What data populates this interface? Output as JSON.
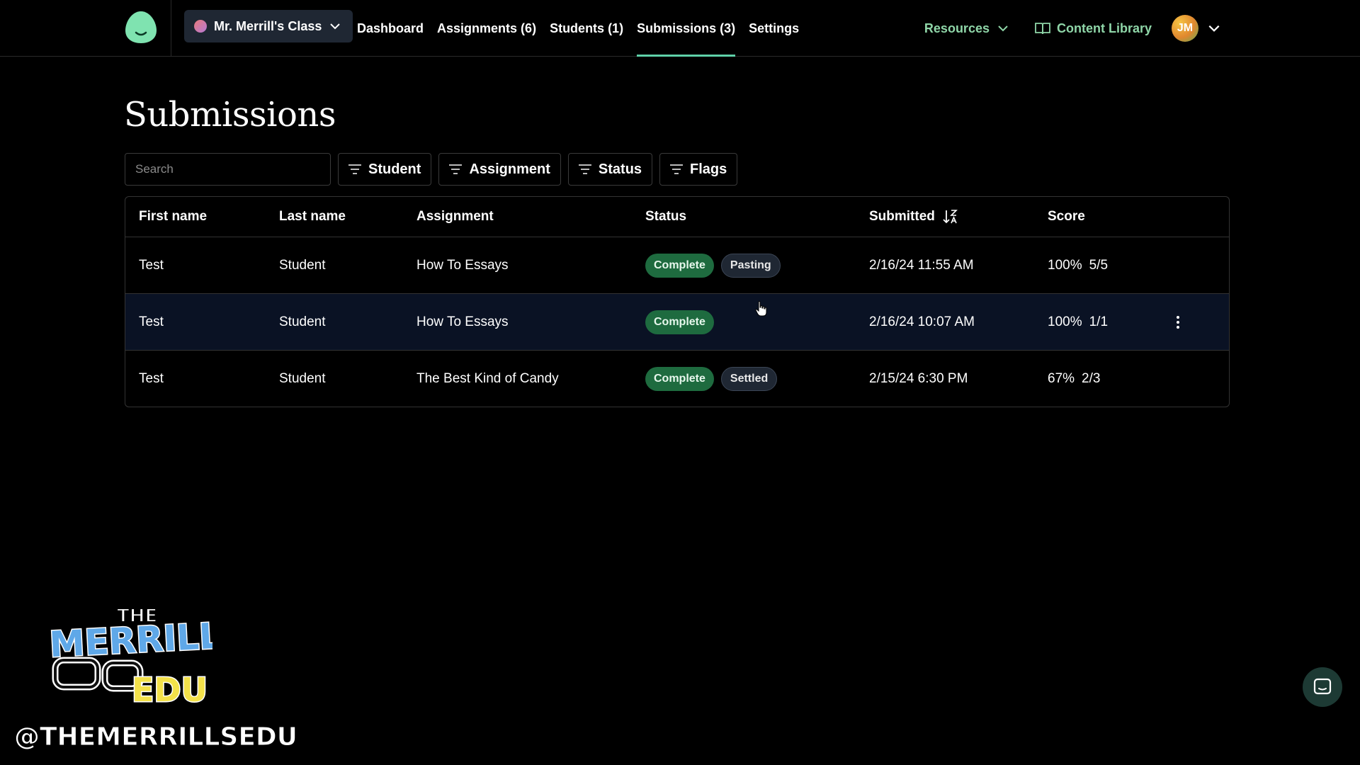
{
  "nav": {
    "class_name": "Mr. Merrill's Class",
    "links": [
      "Dashboard",
      "Assignments (6)",
      "Students (1)",
      "Submissions (3)",
      "Settings"
    ],
    "active": "Submissions (3)",
    "resources": "Resources",
    "content_library": "Content Library",
    "avatar_initials": "JM"
  },
  "page": {
    "title": "Submissions",
    "search_placeholder": "Search",
    "filters": [
      "Student",
      "Assignment",
      "Status",
      "Flags"
    ]
  },
  "table": {
    "headers": {
      "first": "First name",
      "last": "Last name",
      "assignment": "Assignment",
      "status": "Status",
      "submitted": "Submitted",
      "score": "Score"
    },
    "rows": [
      {
        "first": "Test",
        "last": "Student",
        "assignment": "How To Essays",
        "status": "Complete",
        "flag": "Pasting",
        "submitted": "2/16/24 11:55 AM",
        "score_pct": "100%",
        "score_frac": "5/5"
      },
      {
        "first": "Test",
        "last": "Student",
        "assignment": "How To Essays",
        "status": "Complete",
        "flag": "",
        "submitted": "2/16/24 10:07 AM",
        "score_pct": "100%",
        "score_frac": "1/1"
      },
      {
        "first": "Test",
        "last": "Student",
        "assignment": "The Best Kind of Candy",
        "status": "Complete",
        "flag": "Settled",
        "submitted": "2/15/24 6:30 PM",
        "score_pct": "67%",
        "score_frac": "2/3"
      }
    ]
  },
  "watermark": {
    "logo_top": "THE",
    "logo_main": "MERRILLS",
    "logo_bottom": "EDU",
    "handle": "@THEMERRILLSEDU"
  },
  "colors": {
    "accent": "#5fd0a8",
    "link": "#8fd6a8",
    "complete_badge": "#1e6b3f",
    "flag_badge": "#1f2733"
  }
}
